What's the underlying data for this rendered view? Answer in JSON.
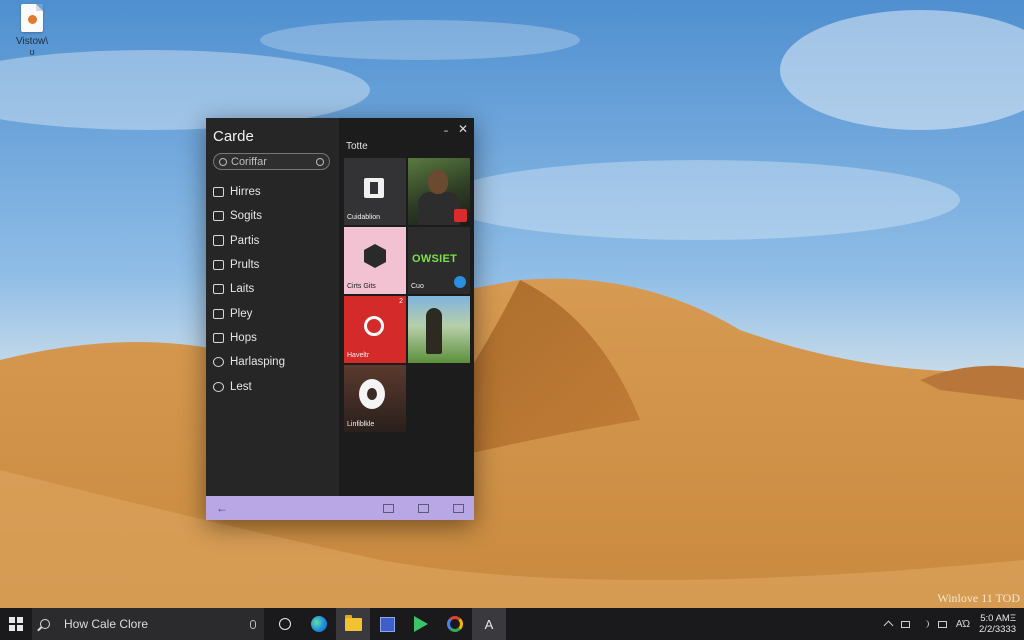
{
  "desktop": {
    "icon_label": "Vistow\\",
    "icon_sublabel": "ʊ"
  },
  "window": {
    "app_title": "Carde",
    "search_placeholder": "Coriffar",
    "section_title": "Totte",
    "controls": {
      "minimize": "˗",
      "close": "✕"
    },
    "nav": [
      {
        "label": "Hirres",
        "icon": "home-icon"
      },
      {
        "label": "Sogits",
        "icon": "list-icon"
      },
      {
        "label": "Partis",
        "icon": "grid-icon"
      },
      {
        "label": "Prults",
        "icon": "card-icon"
      },
      {
        "label": "Laits",
        "icon": "tag-icon"
      },
      {
        "label": "Pley",
        "icon": "play-icon"
      },
      {
        "label": "Hops",
        "icon": "hop-icon"
      },
      {
        "label": "Harlasping",
        "icon": "gear-icon"
      },
      {
        "label": "Lest",
        "icon": "clock-icon"
      }
    ],
    "tiles": [
      {
        "caption": "Cuidablion"
      },
      {
        "caption": ""
      },
      {
        "caption": "Cirts Gits"
      },
      {
        "caption": "Cuo",
        "word": "OWSIET"
      },
      {
        "caption": "Haveltr",
        "mini": "2"
      },
      {
        "caption": ""
      },
      {
        "caption": "Linfiblkle"
      }
    ],
    "bottom_bar": {
      "back": "←"
    },
    "colors": {
      "accent_bar": "#b9a6e4",
      "window_bg": "#242424"
    }
  },
  "watermark": "Winlove 11 TOD",
  "taskbar": {
    "search_placeholder": "How Cale Clore",
    "apps": [
      "cortana-icon",
      "edge-icon",
      "file-explorer-icon",
      "store-icon",
      "play-store-icon",
      "chrome-icon",
      "font-app-icon"
    ],
    "active_app_glyph": "A",
    "tray_lang": "ΑΏ",
    "clock_time": "5:0 ΑΜΞ",
    "clock_date": "2/2/3333"
  }
}
